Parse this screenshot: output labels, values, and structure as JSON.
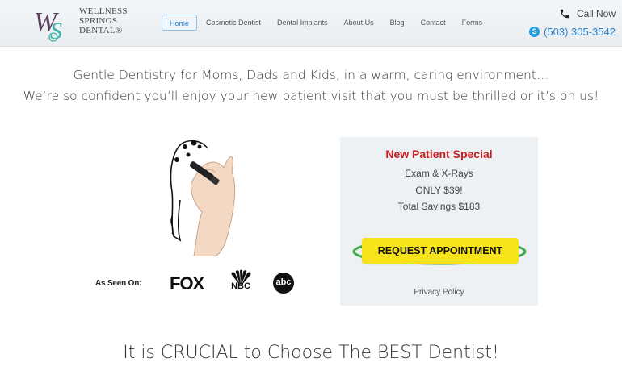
{
  "logo": {
    "line1": "WELLNESS",
    "line2": "SPRINGS",
    "line3": "DENTAL®",
    "mark": "WS"
  },
  "nav": {
    "items": [
      {
        "label": "Home",
        "active": true
      },
      {
        "label": "Cosmetic Dentist",
        "active": false
      },
      {
        "label": "Dental Implants",
        "active": false
      },
      {
        "label": "About Us",
        "active": false
      },
      {
        "label": "Blog",
        "active": false
      },
      {
        "label": "Contact",
        "active": false
      },
      {
        "label": "Forms",
        "active": false
      }
    ]
  },
  "call": {
    "label": "Call Now",
    "phone": "(503) 305-3542",
    "phone_icon": "phone-icon",
    "skype_icon": "skype-icon"
  },
  "tagline": {
    "line1": "Gentle Dentistry for Moms, Dads and Kids, in a warm, caring environment…",
    "line2": "We’re so confident you’ll enjoy your new patient visit that you must be thrilled or it’s on us!"
  },
  "media": {
    "label": "As Seen On:",
    "fox": "FOX",
    "nbc": "NBC",
    "abc": "abc"
  },
  "special": {
    "title": "New Patient Special",
    "line1": "Exam & X-Rays",
    "line2": "ONLY $39!",
    "line3": "Total Savings $183",
    "cta": "REQUEST APPOINTMENT",
    "privacy": "Privacy Policy"
  },
  "headline": "It is CRUCIAL to Choose The BEST Dentist!",
  "colors": {
    "accent_blue": "#2a84d2",
    "special_red": "#c81e1e",
    "cta_yellow": "#f7e31a",
    "ring_green": "#3faa4a"
  }
}
